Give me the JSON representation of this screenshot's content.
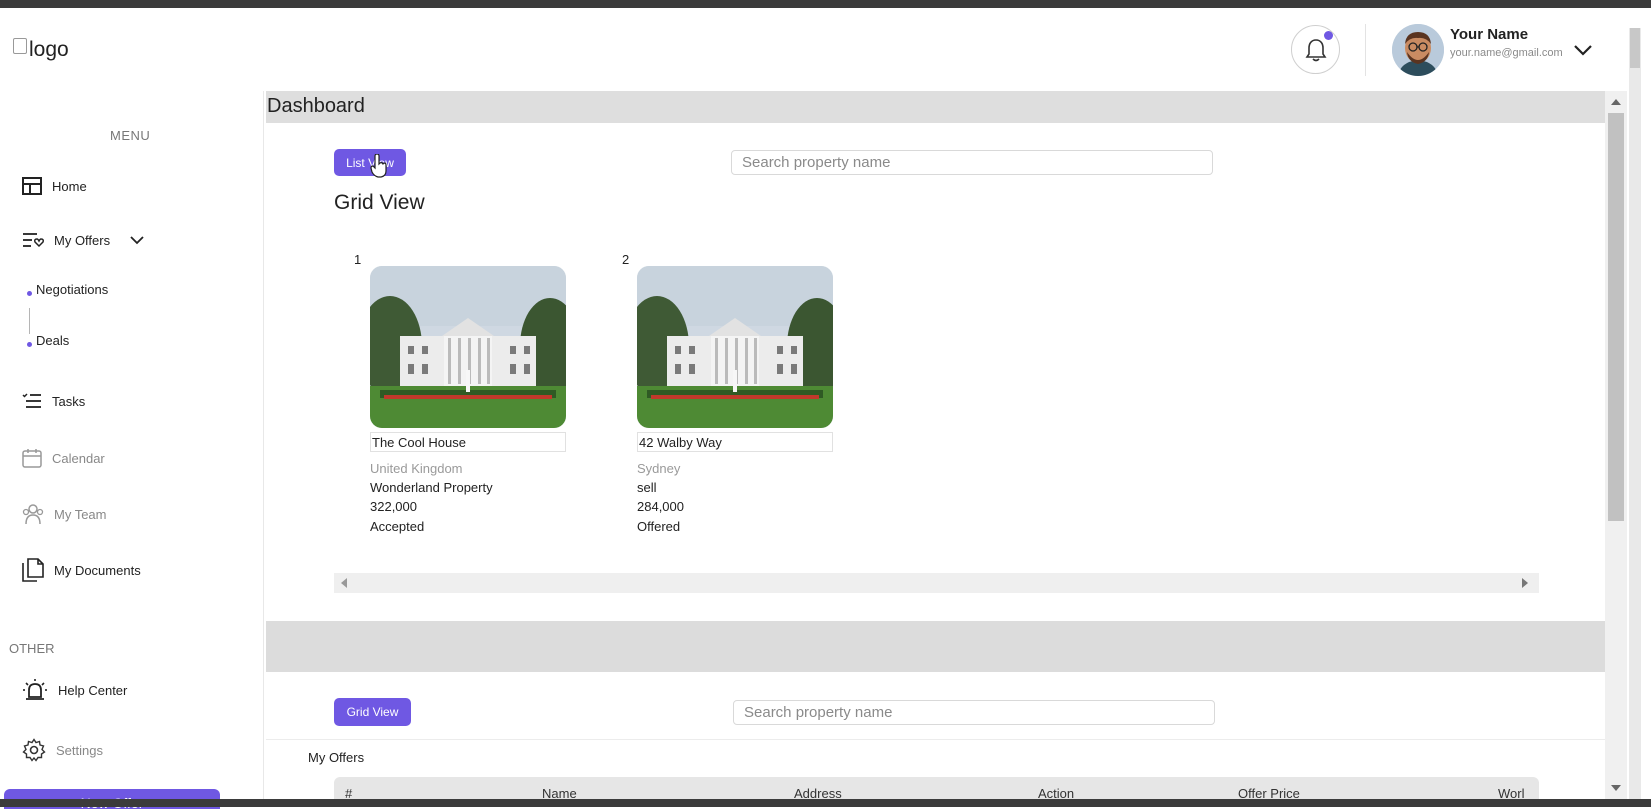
{
  "header": {
    "logo_alt": "logo",
    "user_name": "Your Name",
    "user_email": "your.name@gmail.com",
    "icons": [
      "bell-icon",
      "chevron-down-icon"
    ]
  },
  "sidebar": {
    "menu_title": "MENU",
    "items": [
      {
        "label": "Home",
        "icon": "grid-icon"
      },
      {
        "label": "My Offers",
        "icon": "offers-list-icon"
      },
      {
        "label": "Tasks",
        "icon": "tasks-icon"
      },
      {
        "label": "Calendar",
        "icon": "calendar-icon"
      },
      {
        "label": "My Team",
        "icon": "team-icon"
      },
      {
        "label": "My Documents",
        "icon": "documents-icon"
      }
    ],
    "sub_items": [
      "Negotiations",
      "Deals"
    ],
    "other_title": "OTHER",
    "other_items": [
      {
        "label": "Help Center",
        "icon": "alarm-icon"
      },
      {
        "label": "Settings",
        "icon": "gear-icon"
      }
    ],
    "new_offer_label": "New Offer"
  },
  "main": {
    "page_title": "Dashboard",
    "list_view_label": "List View",
    "grid_view_label": "Grid View",
    "search_placeholder": "Search property name",
    "grid_title": "Grid View",
    "cards": [
      {
        "num": "1",
        "name": "The Cool House",
        "location": "United Kingdom",
        "property": "Wonderland Property",
        "price": "322,000",
        "status": "Accepted"
      },
      {
        "num": "2",
        "name": "42 Walby Way",
        "location": "Sydney",
        "property": "sell",
        "price": "284,000",
        "status": "Offered"
      }
    ],
    "offers_title": "My Offers",
    "table_headers": [
      "#",
      "Name",
      "Address",
      "Action",
      "Offer Price",
      "Worl"
    ]
  },
  "colors": {
    "accent": "#6f58e3",
    "band": "#dcdcdc"
  }
}
